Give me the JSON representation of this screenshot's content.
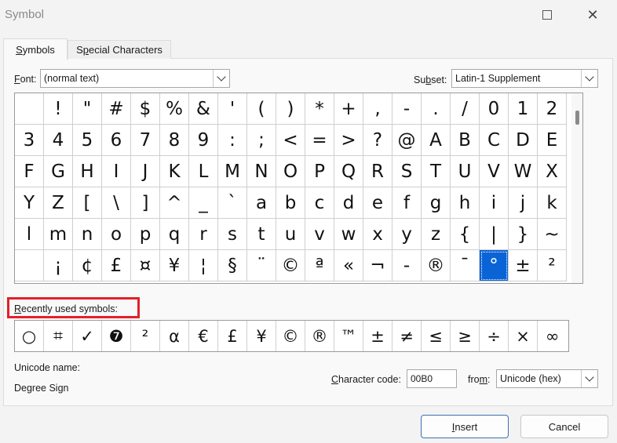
{
  "window": {
    "title": "Symbol"
  },
  "tabs": [
    {
      "label": "Symbols",
      "key": "S"
    },
    {
      "label": "Special Characters",
      "key": "p"
    }
  ],
  "font": {
    "label": "Font:",
    "value": "(normal text)"
  },
  "subset": {
    "label": "Subset:",
    "value": "Latin-1 Supplement"
  },
  "symbols": [
    " ",
    "!",
    "\"",
    "#",
    "$",
    "%",
    "&",
    "'",
    "(",
    ")",
    "*",
    "+",
    ",",
    "-",
    ".",
    "/",
    "0",
    "1",
    "2",
    "3",
    "4",
    "5",
    "6",
    "7",
    "8",
    "9",
    ":",
    ";",
    "<",
    "=",
    ">",
    "?",
    "@",
    "A",
    "B",
    "C",
    "D",
    "E",
    "F",
    "G",
    "H",
    "I",
    "J",
    "K",
    "L",
    "M",
    "N",
    "O",
    "P",
    "Q",
    "R",
    "S",
    "T",
    "U",
    "V",
    "W",
    "X",
    "Y",
    "Z",
    "[",
    "\\",
    "]",
    "^",
    "_",
    "`",
    "a",
    "b",
    "c",
    "d",
    "e",
    "f",
    "g",
    "h",
    "i",
    "j",
    "k",
    "l",
    "m",
    "n",
    "o",
    "p",
    "q",
    "r",
    "s",
    "t",
    "u",
    "v",
    "w",
    "x",
    "y",
    "z",
    "{",
    "|",
    "}",
    "~",
    " ",
    "¡",
    "¢",
    "£",
    "¤",
    "¥",
    "¦",
    "§",
    "¨",
    "©",
    "ª",
    "«",
    "¬",
    "-",
    "®",
    "¯",
    "°",
    "±",
    "²"
  ],
  "selected_symbol": "°",
  "recent": {
    "label": "Recently used symbols:",
    "items": [
      "○",
      "⌗",
      "✓",
      "❼",
      "²",
      "α",
      "€",
      "£",
      "¥",
      "©",
      "®",
      "™",
      "±",
      "≠",
      "≤",
      "≥",
      "÷",
      "×",
      "∞"
    ]
  },
  "unicode": {
    "label": "Unicode name:",
    "value": "Degree Sign"
  },
  "charcode": {
    "label": "Character code:",
    "value": "00B0"
  },
  "from": {
    "label": "from:",
    "value": "Unicode (hex)"
  },
  "buttons": {
    "insert": "Insert",
    "cancel": "Cancel"
  }
}
